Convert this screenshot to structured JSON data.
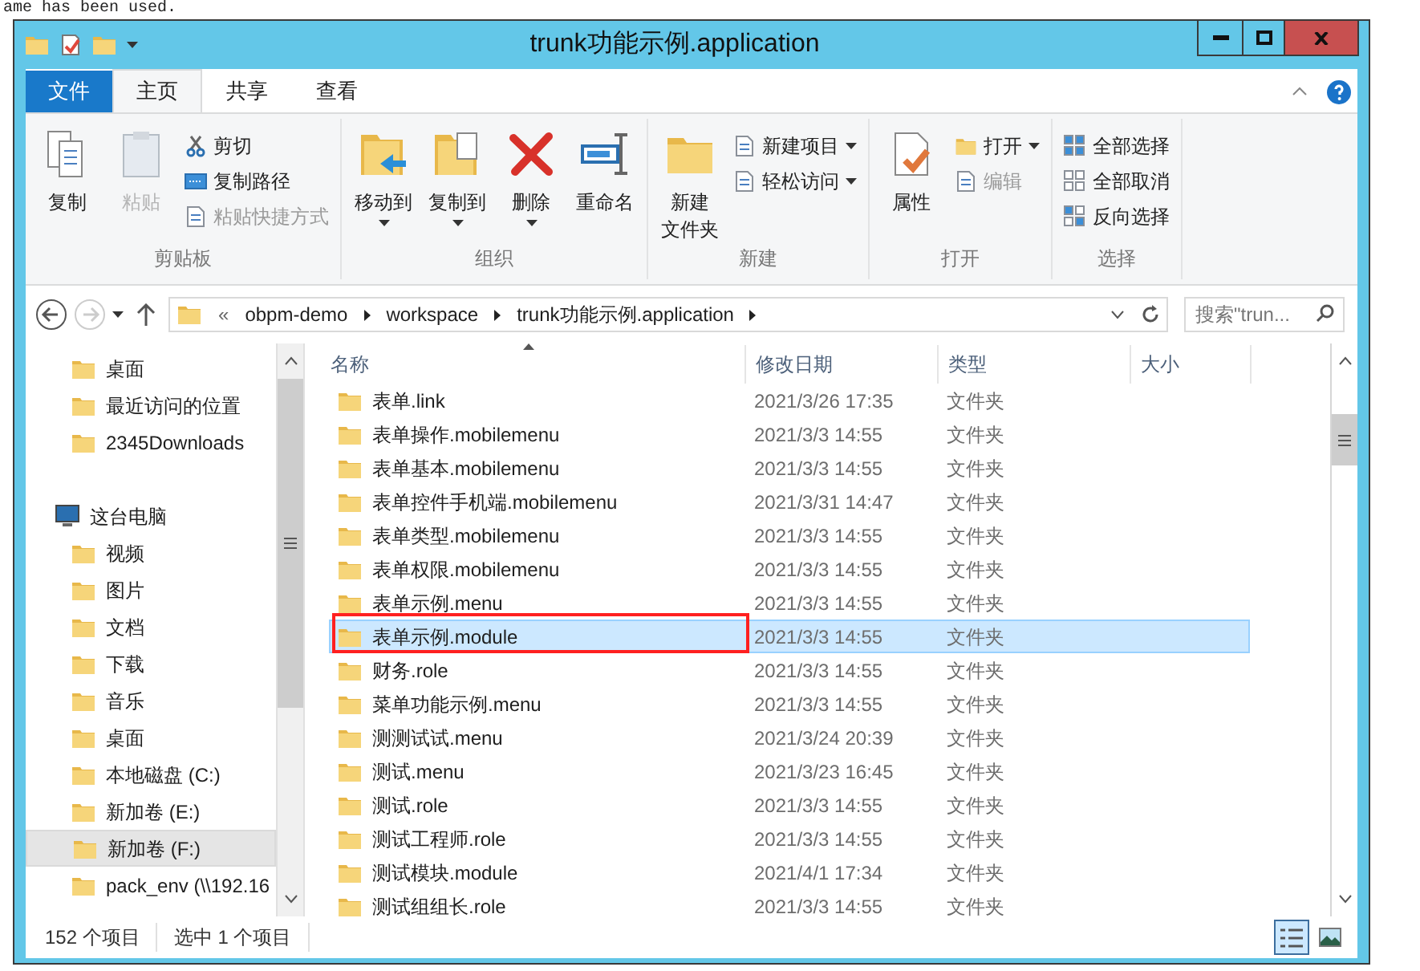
{
  "background_text": "ame has been used.",
  "window": {
    "title": "trunk功能示例.application"
  },
  "ribbon_tabs": [
    {
      "label": "文件",
      "kind": "file",
      "selected": false
    },
    {
      "label": "主页",
      "kind": "tab",
      "selected": true
    },
    {
      "label": "共享",
      "kind": "tab",
      "selected": false
    },
    {
      "label": "查看",
      "kind": "tab",
      "selected": false
    }
  ],
  "ribbon_groups": [
    {
      "label": "剪贴板",
      "items": [
        {
          "label": "复制",
          "kind": "large",
          "disabled": false,
          "dropdown": false
        },
        {
          "label": "粘贴",
          "kind": "large",
          "disabled": true,
          "dropdown": false
        },
        {
          "label": "剪切",
          "kind": "small",
          "disabled": false,
          "dropdown": false
        },
        {
          "label": "复制路径",
          "kind": "small",
          "disabled": false,
          "dropdown": false
        },
        {
          "label": "粘贴快捷方式",
          "kind": "small",
          "disabled": true,
          "dropdown": false
        }
      ]
    },
    {
      "label": "组织",
      "items": [
        {
          "label": "移动到",
          "kind": "large",
          "disabled": false,
          "dropdown": true
        },
        {
          "label": "复制到",
          "kind": "large",
          "disabled": false,
          "dropdown": true
        },
        {
          "label": "删除",
          "kind": "large",
          "disabled": false,
          "dropdown": true
        },
        {
          "label": "重命名",
          "kind": "large",
          "disabled": false,
          "dropdown": false
        }
      ]
    },
    {
      "label": "新建",
      "items": [
        {
          "lines": [
            "新建",
            "文件夹"
          ],
          "kind": "large",
          "disabled": false,
          "dropdown": false
        },
        {
          "label": "新建项目",
          "kind": "small",
          "disabled": false,
          "dropdown": true
        },
        {
          "label": "轻松访问",
          "kind": "small",
          "disabled": false,
          "dropdown": true
        }
      ]
    },
    {
      "label": "打开",
      "items": [
        {
          "label": "属性",
          "kind": "large",
          "disabled": false,
          "dropdown": false
        },
        {
          "label": "打开",
          "kind": "small",
          "disabled": false,
          "dropdown": true
        },
        {
          "label": "编辑",
          "kind": "small",
          "disabled": true,
          "dropdown": false
        }
      ]
    },
    {
      "label": "选择",
      "items": [
        {
          "label": "全部选择",
          "kind": "small",
          "disabled": false,
          "dropdown": false
        },
        {
          "label": "全部取消",
          "kind": "small",
          "disabled": false,
          "dropdown": false
        },
        {
          "label": "反向选择",
          "kind": "small",
          "disabled": false,
          "dropdown": false
        }
      ]
    }
  ],
  "address_bar": {
    "overflow": "«",
    "crumbs": [
      "obpm-demo",
      "workspace",
      "trunk功能示例.application"
    ]
  },
  "search": {
    "placeholder": "搜索\"trun..."
  },
  "nav_pane": {
    "groups": [
      {
        "items": [
          {
            "label": "桌面",
            "selected": false
          },
          {
            "label": "最近访问的位置",
            "selected": false
          },
          {
            "label": "2345Downloads",
            "selected": false
          }
        ]
      },
      {
        "label": "这台电脑",
        "items": [
          {
            "label": "视频",
            "selected": false
          },
          {
            "label": "图片",
            "selected": false
          },
          {
            "label": "文档",
            "selected": false
          },
          {
            "label": "下载",
            "selected": false
          },
          {
            "label": "音乐",
            "selected": false
          },
          {
            "label": "桌面",
            "selected": false
          },
          {
            "label": "本地磁盘 (C:)",
            "selected": false
          },
          {
            "label": "新加卷 (E:)",
            "selected": false
          },
          {
            "label": "新加卷 (F:)",
            "selected": true
          },
          {
            "label": "pack_env (\\\\192.16",
            "selected": false
          }
        ]
      }
    ]
  },
  "table": {
    "columns": [
      "名称",
      "修改日期",
      "类型",
      "大小"
    ],
    "rows": [
      {
        "name": "表单.link",
        "modified": "2021/3/26 17:35",
        "type": "文件夹",
        "selected": false
      },
      {
        "name": "表单操作.mobilemenu",
        "modified": "2021/3/3 14:55",
        "type": "文件夹",
        "selected": false
      },
      {
        "name": "表单基本.mobilemenu",
        "modified": "2021/3/3 14:55",
        "type": "文件夹",
        "selected": false
      },
      {
        "name": "表单控件手机端.mobilemenu",
        "modified": "2021/3/31 14:47",
        "type": "文件夹",
        "selected": false
      },
      {
        "name": "表单类型.mobilemenu",
        "modified": "2021/3/3 14:55",
        "type": "文件夹",
        "selected": false
      },
      {
        "name": "表单权限.mobilemenu",
        "modified": "2021/3/3 14:55",
        "type": "文件夹",
        "selected": false
      },
      {
        "name": "表单示例.menu",
        "modified": "2021/3/3 14:55",
        "type": "文件夹",
        "selected": false
      },
      {
        "name": "表单示例.module",
        "modified": "2021/3/3 14:55",
        "type": "文件夹",
        "selected": true
      },
      {
        "name": "财务.role",
        "modified": "2021/3/3 14:55",
        "type": "文件夹",
        "selected": false
      },
      {
        "name": "菜单功能示例.menu",
        "modified": "2021/3/3 14:55",
        "type": "文件夹",
        "selected": false
      },
      {
        "name": "测测试试.menu",
        "modified": "2021/3/24 20:39",
        "type": "文件夹",
        "selected": false
      },
      {
        "name": "测试.menu",
        "modified": "2021/3/23 16:45",
        "type": "文件夹",
        "selected": false
      },
      {
        "name": "测试.role",
        "modified": "2021/3/3 14:55",
        "type": "文件夹",
        "selected": false
      },
      {
        "name": "测试工程师.role",
        "modified": "2021/3/3 14:55",
        "type": "文件夹",
        "selected": false
      },
      {
        "name": "测试模块.module",
        "modified": "2021/4/1 17:34",
        "type": "文件夹",
        "selected": false
      },
      {
        "name": "测试组组长.role",
        "modified": "2021/3/3 14:55",
        "type": "文件夹",
        "selected": false
      }
    ]
  },
  "status_bar": {
    "item_count": "152 个项目",
    "selection": "选中 1 个项目"
  },
  "view_buttons": [
    {
      "kind": "details",
      "selected": true
    },
    {
      "kind": "large_icons",
      "selected": false
    }
  ]
}
